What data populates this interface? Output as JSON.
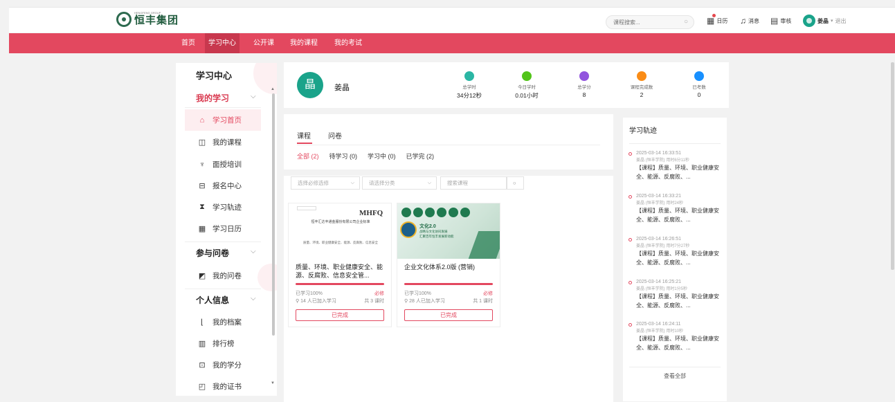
{
  "header": {
    "logo_text": "恒丰集团",
    "logo_subtext": "HENGFENG GROUP",
    "search_placeholder": "课程搜索...",
    "calendar_label": "日历",
    "messages_label": "消息",
    "review_label": "审核",
    "user_name": "姜晶",
    "logout_label": "退出"
  },
  "nav": [
    "首页",
    "学习中心",
    "公开课",
    "我的课程",
    "我的考试"
  ],
  "sidebar": {
    "title": "学习中心",
    "groups": [
      {
        "label": "我的学习",
        "items": [
          "学习首页",
          "我的课程",
          "面授培训",
          "报名中心",
          "学习轨迹",
          "学习日历"
        ]
      },
      {
        "label": "参与问卷",
        "items": [
          "我的问卷"
        ]
      },
      {
        "label": "个人信息",
        "items": [
          "我的档案",
          "排行榜",
          "我的学分",
          "我的证书"
        ]
      }
    ]
  },
  "profile": {
    "avatar_char": "晶",
    "name": "姜晶",
    "stats": [
      {
        "label": "总学时",
        "value": "34分12秒",
        "color": "#2bb6a4"
      },
      {
        "label": "今日学时",
        "value": "0.01小时",
        "color": "#52c41a"
      },
      {
        "label": "总学分",
        "value": "8",
        "color": "#9254de"
      },
      {
        "label": "课程完成数",
        "value": "2",
        "color": "#fa8c16"
      },
      {
        "label": "已考数",
        "value": "0",
        "color": "#1890ff"
      }
    ]
  },
  "tabs": [
    "课程",
    "问卷"
  ],
  "filters": [
    "全部 (2)",
    "待学习 (0)",
    "学习中 (0)",
    "已学完 (2)"
  ],
  "selects": {
    "required": "选择必修选修",
    "category": "请选择分类",
    "search": "搜索课程"
  },
  "courses": [
    {
      "title": "质量、环境、职业健康安全、能源、反腐败、信息安全管...",
      "progress_label": "已学习100%",
      "progress": 100,
      "tag": "必修",
      "learners": "14 人已加入学习",
      "lessons": "共 3 课时",
      "status": "已完成",
      "cover_brand": "MHFQ",
      "cover_title": "恒丰汇达丰通金服份有限公司企业标准",
      "cover_caption": "质量、环境、职业健康安全、能源、反腐败、信息安全"
    },
    {
      "title": "企业文化体系2.0版 (营销)",
      "progress_label": "已学习100%",
      "progress": 100,
      "tag": "必修",
      "learners": "28 人已加入学习",
      "lessons": "共 1 课时",
      "status": "已完成",
      "cover_title": "文化2.0",
      "cover_caption": "战略与文化协同发展",
      "cover_caption2": "汇聚百年恒丰发展新动能"
    }
  ],
  "track": {
    "title": "学习轨迹",
    "entries": [
      {
        "time": "2025-03-14 16:33:51",
        "meta": "姜晶 (恒丰学院)  用时6分11秒",
        "content": "【课程】质量、环境、职业健康安全、能源、反腐败、..."
      },
      {
        "time": "2025-03-14 16:33:21",
        "meta": "姜晶 (恒丰学院)  用时24秒",
        "content": "【课程】质量、环境、职业健康安全、能源、反腐败、..."
      },
      {
        "time": "2025-03-14 16:26:51",
        "meta": "姜晶 (恒丰学院)  用时7分27秒",
        "content": "【课程】质量、环境、职业健康安全、能源、反腐败、..."
      },
      {
        "time": "2025-03-14 16:25:21",
        "meta": "姜晶 (恒丰学院)  用时1分5秒",
        "content": "【课程】质量、环境、职业健康安全、能源、反腐败、..."
      },
      {
        "time": "2025-03-14 16:24:11",
        "meta": "姜晶 (恒丰学院)  用时10秒",
        "content": "【课程】质量、环境、职业健康安全、能源、反腐败、..."
      }
    ],
    "more": "查看全部"
  }
}
